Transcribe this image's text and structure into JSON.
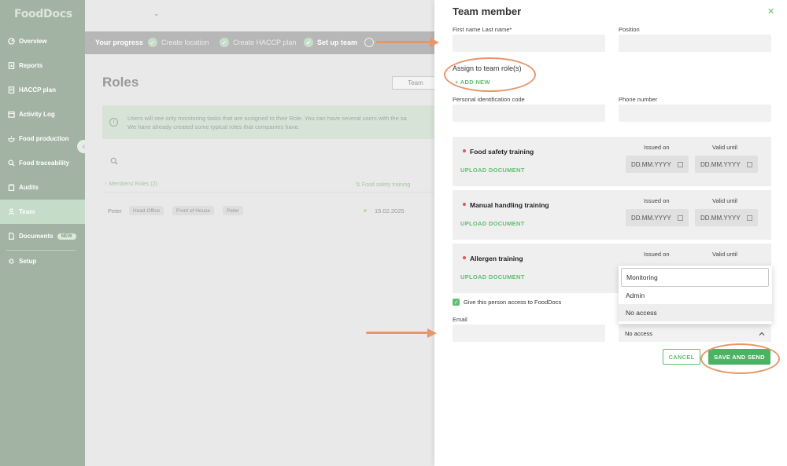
{
  "app": {
    "logo": "FoodDocs"
  },
  "sidebar": {
    "items": [
      {
        "label": "Overview",
        "icon": "overview-icon",
        "active": false
      },
      {
        "label": "Reports",
        "icon": "reports-icon",
        "active": false
      },
      {
        "label": "HACCP plan",
        "icon": "haccp-icon",
        "active": false
      },
      {
        "label": "Activity Log",
        "icon": "activity-icon",
        "active": false
      },
      {
        "label": "Food production",
        "icon": "food-production-icon",
        "active": false
      },
      {
        "label": "Food traceability",
        "icon": "search-icon",
        "active": false
      },
      {
        "label": "Audits",
        "icon": "audits-icon",
        "active": false
      },
      {
        "label": "Team",
        "icon": "person-icon",
        "active": true
      },
      {
        "label": "Documents",
        "icon": "documents-icon",
        "active": false,
        "badge": "NEW"
      },
      {
        "label": "Setup",
        "icon": "gear-icon",
        "active": false
      }
    ]
  },
  "progress": {
    "label": "Your progress",
    "steps": [
      {
        "label": "Create location",
        "state": "done"
      },
      {
        "label": "Create HACCP plan",
        "state": "done"
      },
      {
        "label": "Set up team",
        "state": "current"
      },
      {
        "label": "",
        "state": "pending"
      }
    ]
  },
  "page": {
    "title": "Roles",
    "tab_team": "Team",
    "info_line1": "Users will see only monitoring tasks that are assigned to their Role. You can have several users with the sa",
    "info_line2": "We have already created some typical roles that companies have.",
    "col_members": "Members/ Roles (2)",
    "col_food_safety": "Food safety training",
    "row": {
      "name": "Peter",
      "chips": [
        "Head Office",
        "Front of House",
        "Peter"
      ],
      "date": "15.02.2025"
    }
  },
  "drawer": {
    "title": "Team member",
    "name_label": "First name Last name*",
    "name_value": "",
    "position_label": "Position",
    "position_value": "",
    "assign_label": "Assign to team role(s)",
    "add_new": "ADD NEW",
    "pid_label": "Personal identification code",
    "phone_label": "Phone number",
    "trainings": [
      {
        "name": "Food safety training",
        "upload": "UPLOAD DOCUMENT",
        "issued_label": "Issued on",
        "valid_label": "Valid until",
        "issued_placeholder": "DD.MM.YYYY",
        "valid_placeholder": "DD.MM.YYYY"
      },
      {
        "name": "Manual handling training",
        "upload": "UPLOAD DOCUMENT",
        "issued_label": "Issued on",
        "valid_label": "Valid until",
        "issued_placeholder": "DD.MM.YYYY",
        "valid_placeholder": "DD.MM.YYYY"
      },
      {
        "name": "Allergen training",
        "upload": "UPLOAD DOCUMENT",
        "issued_label": "Issued on",
        "valid_label": "Valid until"
      }
    ],
    "access_label": "Give this person access to FoodDocs",
    "access_checked": true,
    "email_label": "Email",
    "email_value": "",
    "access_dropdown": {
      "options": [
        "Monitoring",
        "Admin",
        "No access"
      ],
      "selected": "No access"
    },
    "cancel": "CANCEL",
    "save": "SAVE AND SEND"
  },
  "colors": {
    "accent": "#5fbf6f",
    "annotation": "#e8956a",
    "sidebar": "#a3b3a3"
  }
}
